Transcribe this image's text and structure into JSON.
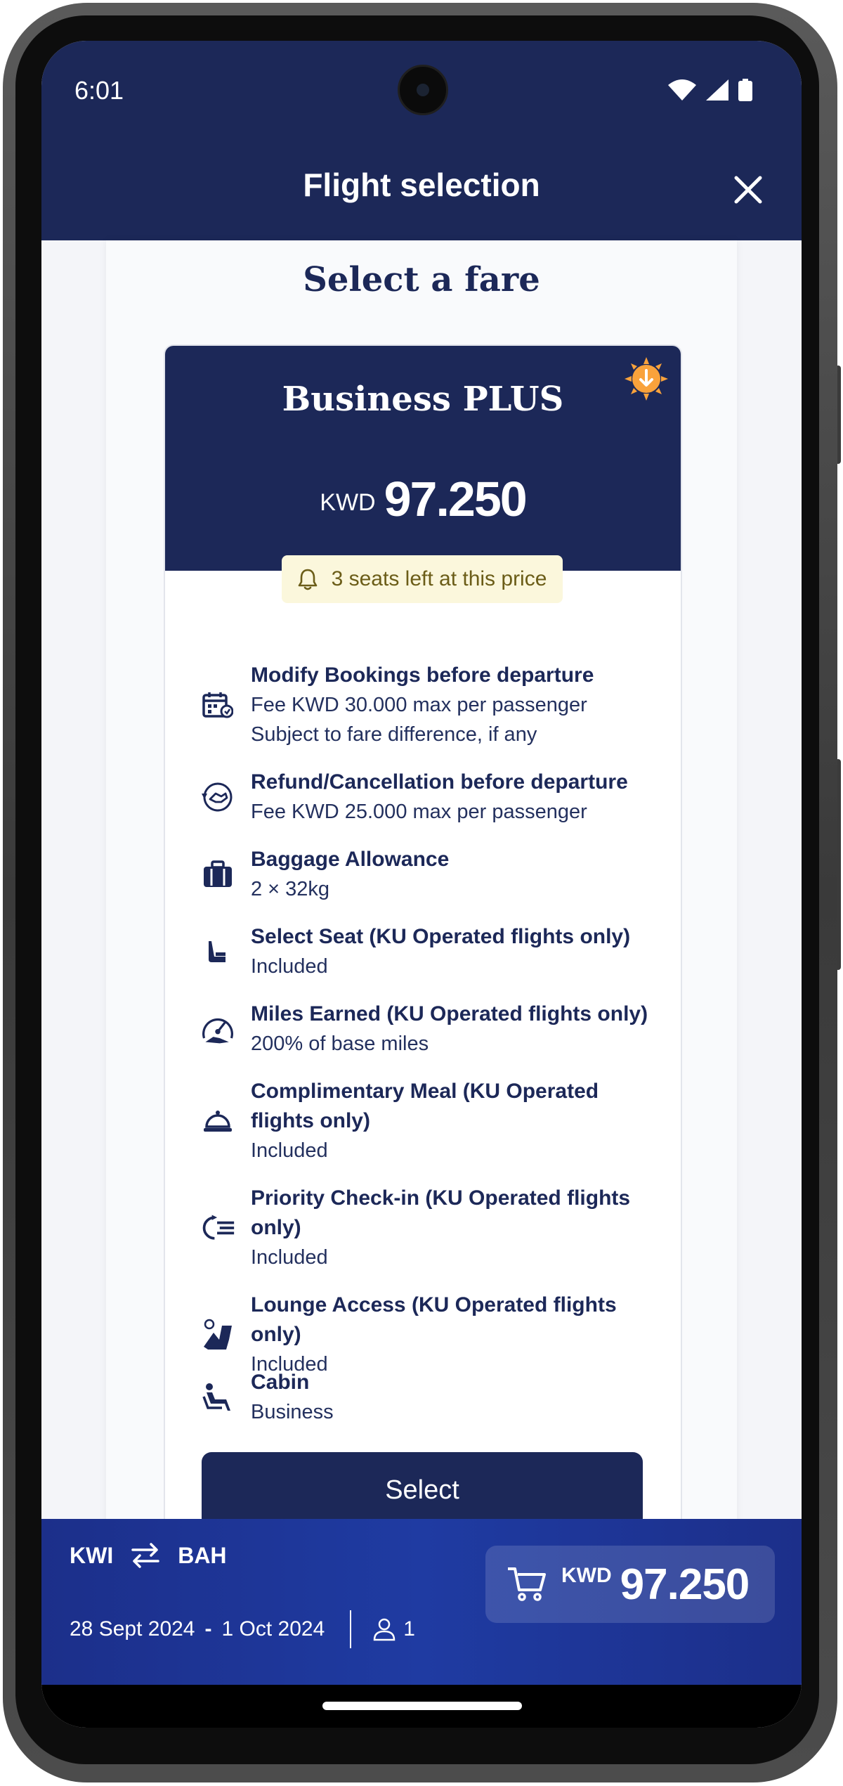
{
  "status": {
    "time": "6:01"
  },
  "header": {
    "title": "Flight selection"
  },
  "section": {
    "title": "Select a fare"
  },
  "fare": {
    "name": "Business PLUS",
    "currency": "KWD",
    "price": "97.250",
    "seats_left": "3 seats left at this price",
    "select_label": "Select",
    "benefits": [
      {
        "icon": "calendar-icon",
        "title": "Modify Bookings before departure",
        "lines": [
          "Fee KWD 30.000 max per passenger",
          "Subject to fare difference, if any"
        ]
      },
      {
        "icon": "refund-icon",
        "title": "Refund/Cancellation before departure",
        "lines": [
          "Fee KWD 25.000 max per passenger"
        ]
      },
      {
        "icon": "baggage-icon",
        "title": "Baggage Allowance",
        "lines": [
          "2 × 32kg"
        ]
      },
      {
        "icon": "seat-icon",
        "title": "Select Seat (KU Operated flights only)",
        "lines": [
          "Included"
        ]
      },
      {
        "icon": "miles-icon",
        "title": "Miles Earned (KU Operated flights only)",
        "lines": [
          "200% of base miles"
        ]
      },
      {
        "icon": "meal-icon",
        "title": "Complimentary Meal (KU Operated flights only)",
        "lines": [
          "Included"
        ]
      },
      {
        "icon": "priority-checkin-icon",
        "title": "Priority Check-in (KU Operated flights only)",
        "lines": [
          "Included"
        ]
      },
      {
        "icon": "lounge-icon",
        "title": "Lounge Access (KU Operated flights only)",
        "lines": [
          "Included"
        ]
      },
      {
        "icon": "cabin-seat-icon",
        "title": "Cabin",
        "lines": [
          "Business"
        ]
      }
    ]
  },
  "summary": {
    "origin": "KWI",
    "destination": "BAH",
    "depart_date": "28 Sept 2024",
    "separator": "-",
    "return_date": "1 Oct 2024",
    "passengers": "1",
    "currency": "KWD",
    "total": "97.250"
  },
  "colors": {
    "primary": "#1c2858",
    "summary_bar": "#1f3ba2",
    "badge": "#f9a23b",
    "seats_pill": "#fbf7dc"
  }
}
